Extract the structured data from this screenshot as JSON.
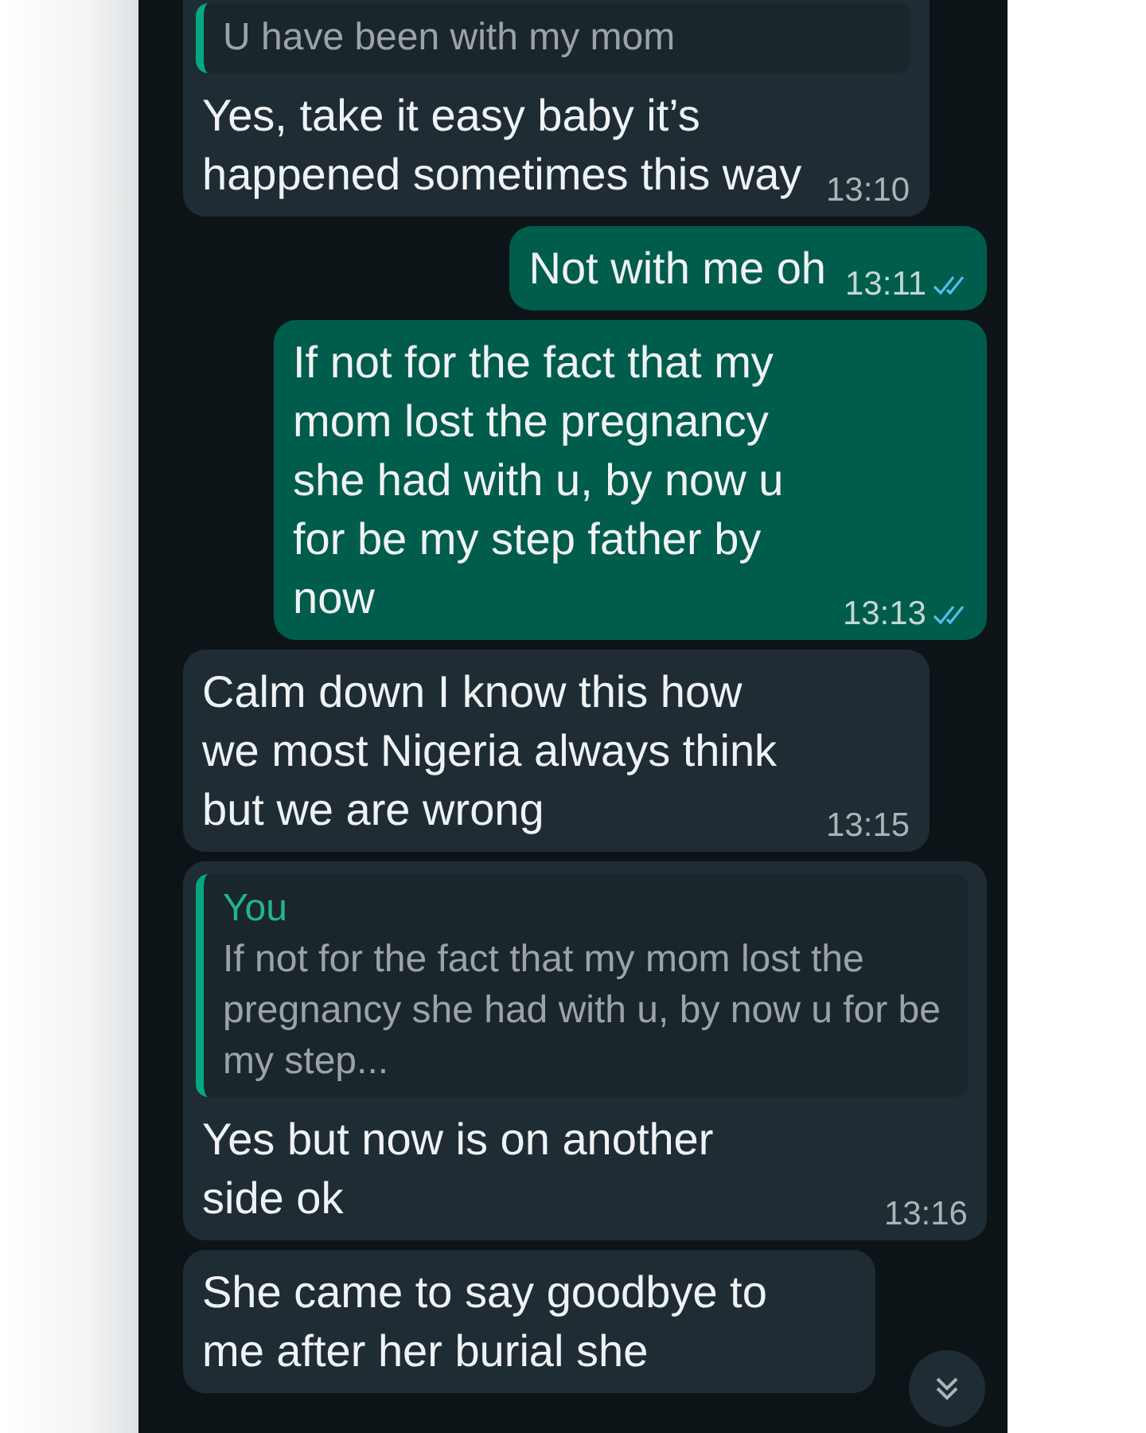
{
  "messages": [
    {
      "kind": "incoming",
      "quote": {
        "text": "U have been with my mom"
      },
      "text": "Yes, take it easy baby it’s happened sometimes this way",
      "time": "13:10"
    },
    {
      "kind": "outgoing",
      "text": "Not with me oh",
      "time": "13:11",
      "read": true
    },
    {
      "kind": "outgoing",
      "text": "If not for the fact that my mom lost the pregnancy she had with u, by now u for be my step father by now",
      "time": "13:13",
      "read": true
    },
    {
      "kind": "incoming",
      "text": "Calm down I know this how we most Nigeria always think but we are wrong",
      "time": "13:15"
    },
    {
      "kind": "incoming",
      "quote": {
        "sender": "You",
        "text": "If not for the fact that my mom lost the pregnancy she had with u, by now u for be my step..."
      },
      "text": "Yes but now is on another side ok",
      "time": "13:16"
    },
    {
      "kind": "incoming",
      "text": "She came to say goodbye to me after her burial she"
    }
  ]
}
